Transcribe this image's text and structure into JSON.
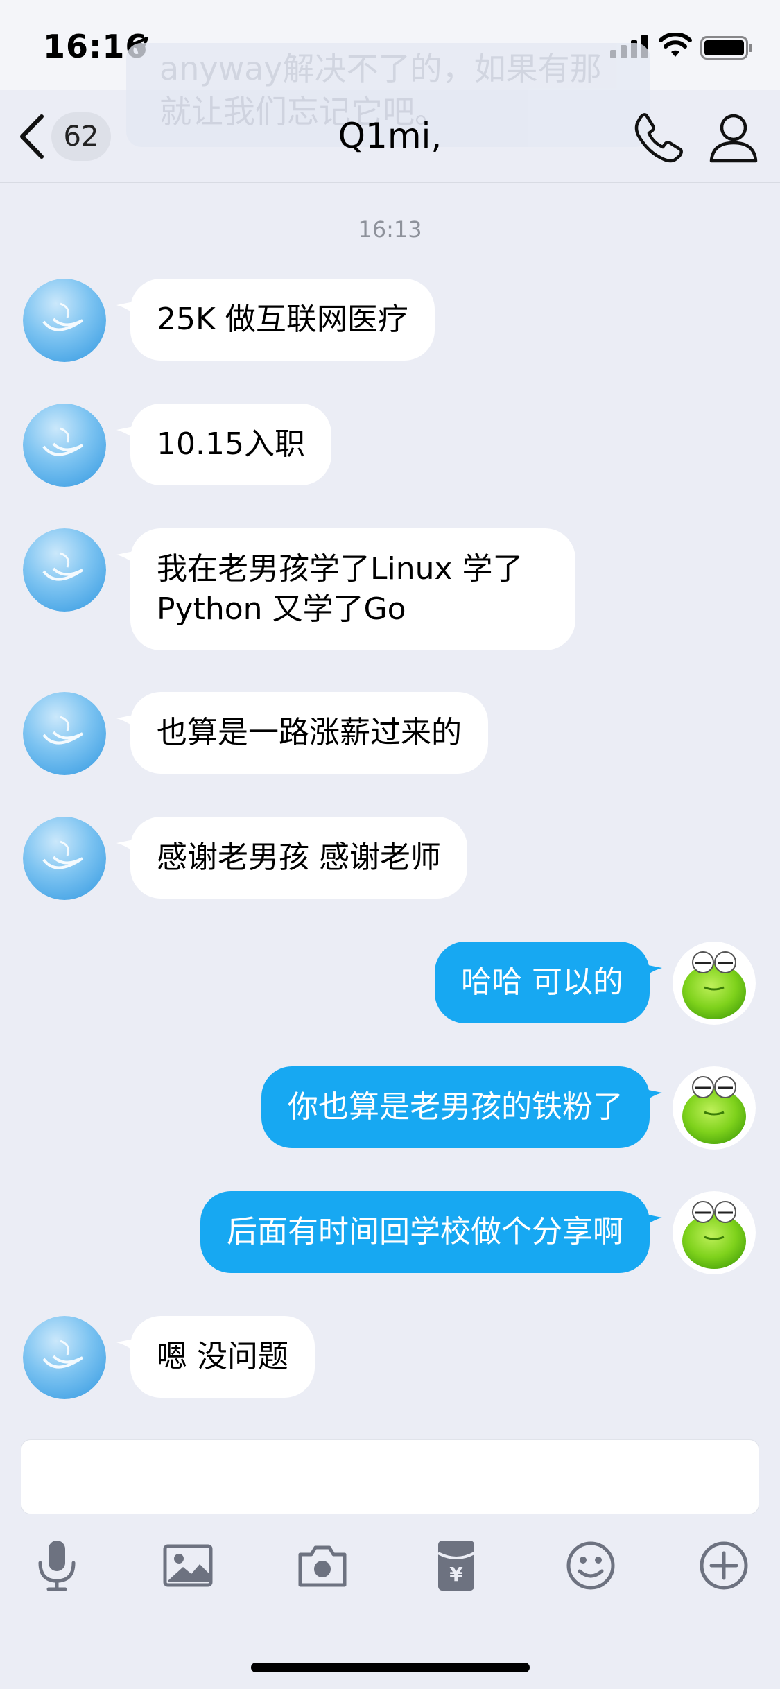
{
  "status_bar": {
    "time": "16:16"
  },
  "ghost_banner": {
    "text": "anyway解决不了的，如果有那\n就让我们忘记它吧。"
  },
  "header": {
    "unread_count": "62",
    "title": "Q1mi,"
  },
  "timestamp": "16:13",
  "messages": [
    {
      "side": "in",
      "text": "25K 做互联网医疗"
    },
    {
      "side": "in",
      "text": "10.15入职"
    },
    {
      "side": "in",
      "text": "我在老男孩学了Linux 学了\nPython 又学了Go"
    },
    {
      "side": "in",
      "text": "也算是一路涨薪过来的"
    },
    {
      "side": "in",
      "text": "感谢老男孩 感谢老师"
    },
    {
      "side": "out",
      "text": "哈哈 可以的"
    },
    {
      "side": "out",
      "text": "你也算是老男孩的铁粉了"
    },
    {
      "side": "out",
      "text": "后面有时间回学校做个分享啊"
    },
    {
      "side": "in",
      "text": "嗯 没问题"
    }
  ],
  "input": {
    "value": ""
  },
  "toolbar": {
    "icons": [
      "microphone-icon",
      "image-icon",
      "camera-icon",
      "red-packet-icon",
      "emoji-icon",
      "plus-icon"
    ]
  },
  "colors": {
    "background": "#ebedf5",
    "outgoing_bubble": "#17a8f2",
    "incoming_bubble": "#ffffff"
  }
}
